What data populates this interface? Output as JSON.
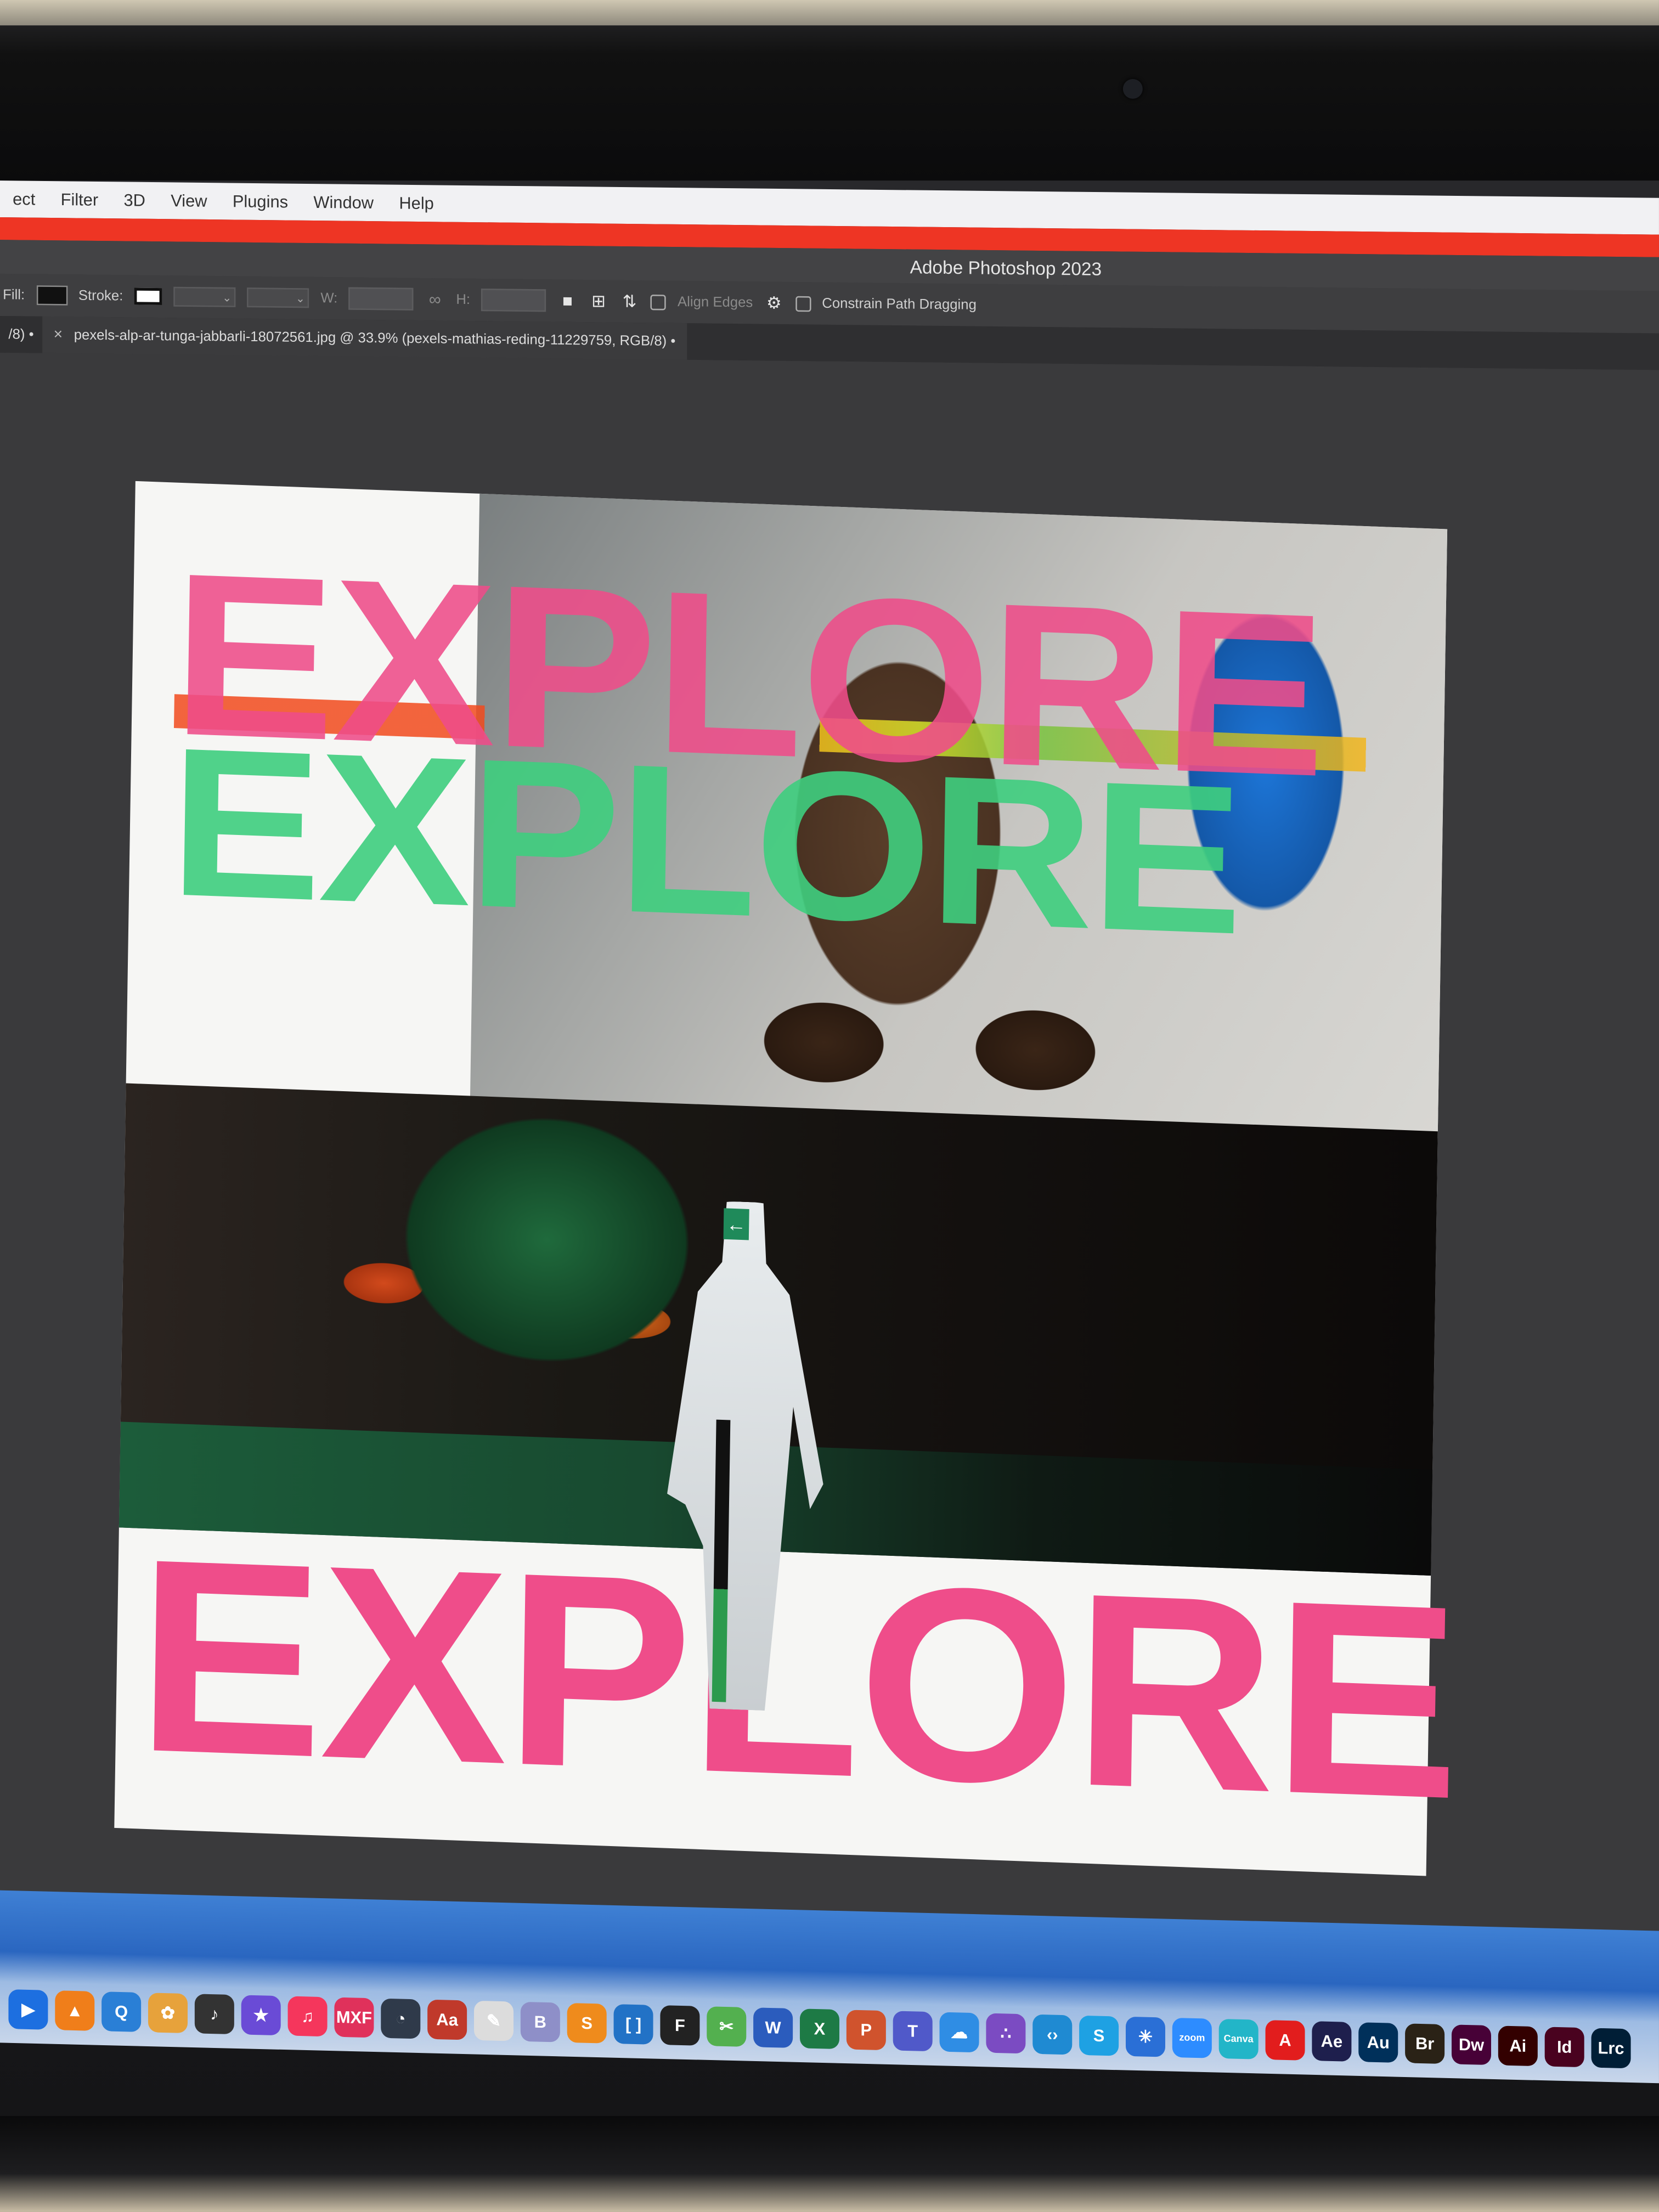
{
  "menubar": {
    "items": [
      "ect",
      "Filter",
      "3D",
      "View",
      "Plugins",
      "Window",
      "Help"
    ]
  },
  "app": {
    "title": "Adobe Photoshop 2023"
  },
  "options_bar": {
    "fill_label": "Fill:",
    "stroke_label": "Stroke:",
    "w_label": "W:",
    "h_label": "H:",
    "align_edges_label": "Align Edges",
    "constrain_label": "Constrain Path Dragging"
  },
  "tabs": {
    "first_partial": "/8) •",
    "active": "pexels-alp-ar-tunga-jabbarli-18072561.jpg @ 33.9% (pexels-mathias-reding-11229759, RGB/8) •"
  },
  "artwork": {
    "word_top": "EXPLORE",
    "word_middle": "EXPLORE",
    "word_bottom": "EXPLORE",
    "exit_sign": "←",
    "colors": {
      "pink": "#ef4d8a",
      "green": "#3fcf7f",
      "orange": "#f24a1d"
    }
  },
  "dock": {
    "apps": [
      {
        "icon": "finder-icon",
        "glyph": "▶",
        "color": "#1d6fe0"
      },
      {
        "icon": "vlc-icon",
        "glyph": "▲",
        "color": "#f07e1a"
      },
      {
        "icon": "quicktime-icon",
        "glyph": "Q",
        "color": "#2a7fd6"
      },
      {
        "icon": "photos-icon",
        "glyph": "✿",
        "color": "#e7a23b"
      },
      {
        "icon": "logic-icon",
        "glyph": "♪",
        "color": "#333333"
      },
      {
        "icon": "imovie-icon",
        "glyph": "★",
        "color": "#6a4bd6"
      },
      {
        "icon": "music-icon",
        "glyph": "♫",
        "color": "#f5365c"
      },
      {
        "icon": "mxf-icon",
        "glyph": "MXF",
        "color": "#e0315b"
      },
      {
        "icon": "davinci-icon",
        "glyph": "◔",
        "color": "#2f3a4a"
      },
      {
        "icon": "dictionary-icon",
        "glyph": "Aa",
        "color": "#c0392b"
      },
      {
        "icon": "notes-icon",
        "glyph": "✎",
        "color": "#dcdcdc"
      },
      {
        "icon": "bbedit-icon",
        "glyph": "B",
        "color": "#8e8fc8"
      },
      {
        "icon": "sublime-icon",
        "glyph": "S",
        "color": "#ef8b1c"
      },
      {
        "icon": "brackets-icon",
        "glyph": "[ ]",
        "color": "#2272c6"
      },
      {
        "icon": "final-cut-icon",
        "glyph": "F",
        "color": "#222222"
      },
      {
        "icon": "film-icon",
        "glyph": "✂",
        "color": "#53b04f"
      },
      {
        "icon": "word-icon",
        "glyph": "W",
        "color": "#2b5cbd"
      },
      {
        "icon": "excel-icon",
        "glyph": "X",
        "color": "#1d7a45"
      },
      {
        "icon": "powerpoint-icon",
        "glyph": "P",
        "color": "#d0532d"
      },
      {
        "icon": "teams-icon",
        "glyph": "T",
        "color": "#5059c9"
      },
      {
        "icon": "onedrive-icon",
        "glyph": "☁",
        "color": "#2f8de4"
      },
      {
        "icon": "visual-studio-icon",
        "glyph": "∴",
        "color": "#7b4bc2"
      },
      {
        "icon": "vscode-icon",
        "glyph": "‹›",
        "color": "#1f8ad2"
      },
      {
        "icon": "skype-icon",
        "glyph": "S",
        "color": "#1ea1e3"
      },
      {
        "icon": "settings-burst-icon",
        "glyph": "✳",
        "color": "#2a6fd6"
      },
      {
        "icon": "zoom-icon",
        "glyph": "zoom",
        "color": "#2d8cff"
      },
      {
        "icon": "canva-icon",
        "glyph": "Canva",
        "color": "#22b5c8"
      },
      {
        "icon": "acrobat-icon",
        "glyph": "A",
        "color": "#e21d1d"
      },
      {
        "icon": "after-effects-icon",
        "glyph": "Ae",
        "color": "#1e1f4d"
      },
      {
        "icon": "audition-icon",
        "glyph": "Au",
        "color": "#00305a"
      },
      {
        "icon": "bridge-icon",
        "glyph": "Br",
        "color": "#2a2216"
      },
      {
        "icon": "dreamweaver-icon",
        "glyph": "Dw",
        "color": "#470137"
      },
      {
        "icon": "illustrator-icon",
        "glyph": "Ai",
        "color": "#330000"
      },
      {
        "icon": "indesign-icon",
        "glyph": "Id",
        "color": "#49021f"
      },
      {
        "icon": "lightroom-classic-icon",
        "glyph": "Lrc",
        "color": "#001e36"
      }
    ]
  }
}
